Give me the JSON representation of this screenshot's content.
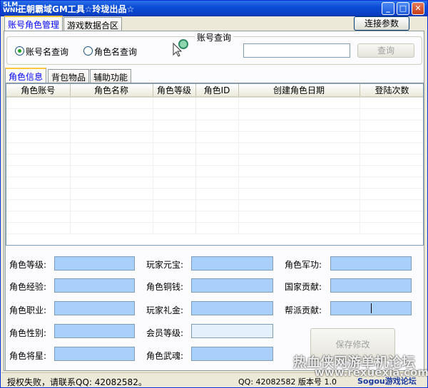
{
  "window": {
    "title": "王朝霸域GM工具☆玲珑出品☆",
    "icon_text": "SLM\nWNH",
    "min_glyph": "_",
    "max_glyph": "□",
    "close_glyph": "✕"
  },
  "main_tabs": [
    {
      "label": "账号角色管理",
      "active": true
    },
    {
      "label": "游戏数据合区",
      "active": false
    }
  ],
  "connect_button": "连接参数",
  "query_group": {
    "title": "账号查询",
    "radio_account": "账号名查询",
    "radio_role": "角色名查询",
    "search_value": "",
    "search_button": "查询"
  },
  "sub_tabs": [
    {
      "label": "角色信息",
      "active": true
    },
    {
      "label": "背包物品",
      "active": false
    },
    {
      "label": "辅助功能",
      "active": false
    }
  ],
  "table": {
    "columns": [
      "角色账号",
      "角色名称",
      "角色等级",
      "角色ID",
      "创建角色日期",
      "登陆次数"
    ],
    "rows": []
  },
  "fields": {
    "col1": [
      "角色等级:",
      "角色经验:",
      "角色职业:",
      "角色性别:",
      "角色将星:"
    ],
    "col2": [
      "玩家元宝:",
      "角色铜钱:",
      "玩家礼金:",
      "会员等级:",
      "角色武魂:"
    ],
    "col3": [
      "角色军功:",
      "国家贡献:",
      "帮派贡献:"
    ]
  },
  "save_button": "保存修改",
  "status": {
    "left": "授权失败，请联系QQ: 42082582。",
    "right": "QQ: 42082582  版本号 1.0"
  },
  "watermark": {
    "line1": "热血侠网游单机论坛",
    "line2": "www.rexuexia.com",
    "line3": "Sogou游戏论坛"
  },
  "colors": {
    "titlebar": "#0a4dd6",
    "field_blue": "#a8d0fa",
    "active_tab_text": "#0000ff"
  }
}
